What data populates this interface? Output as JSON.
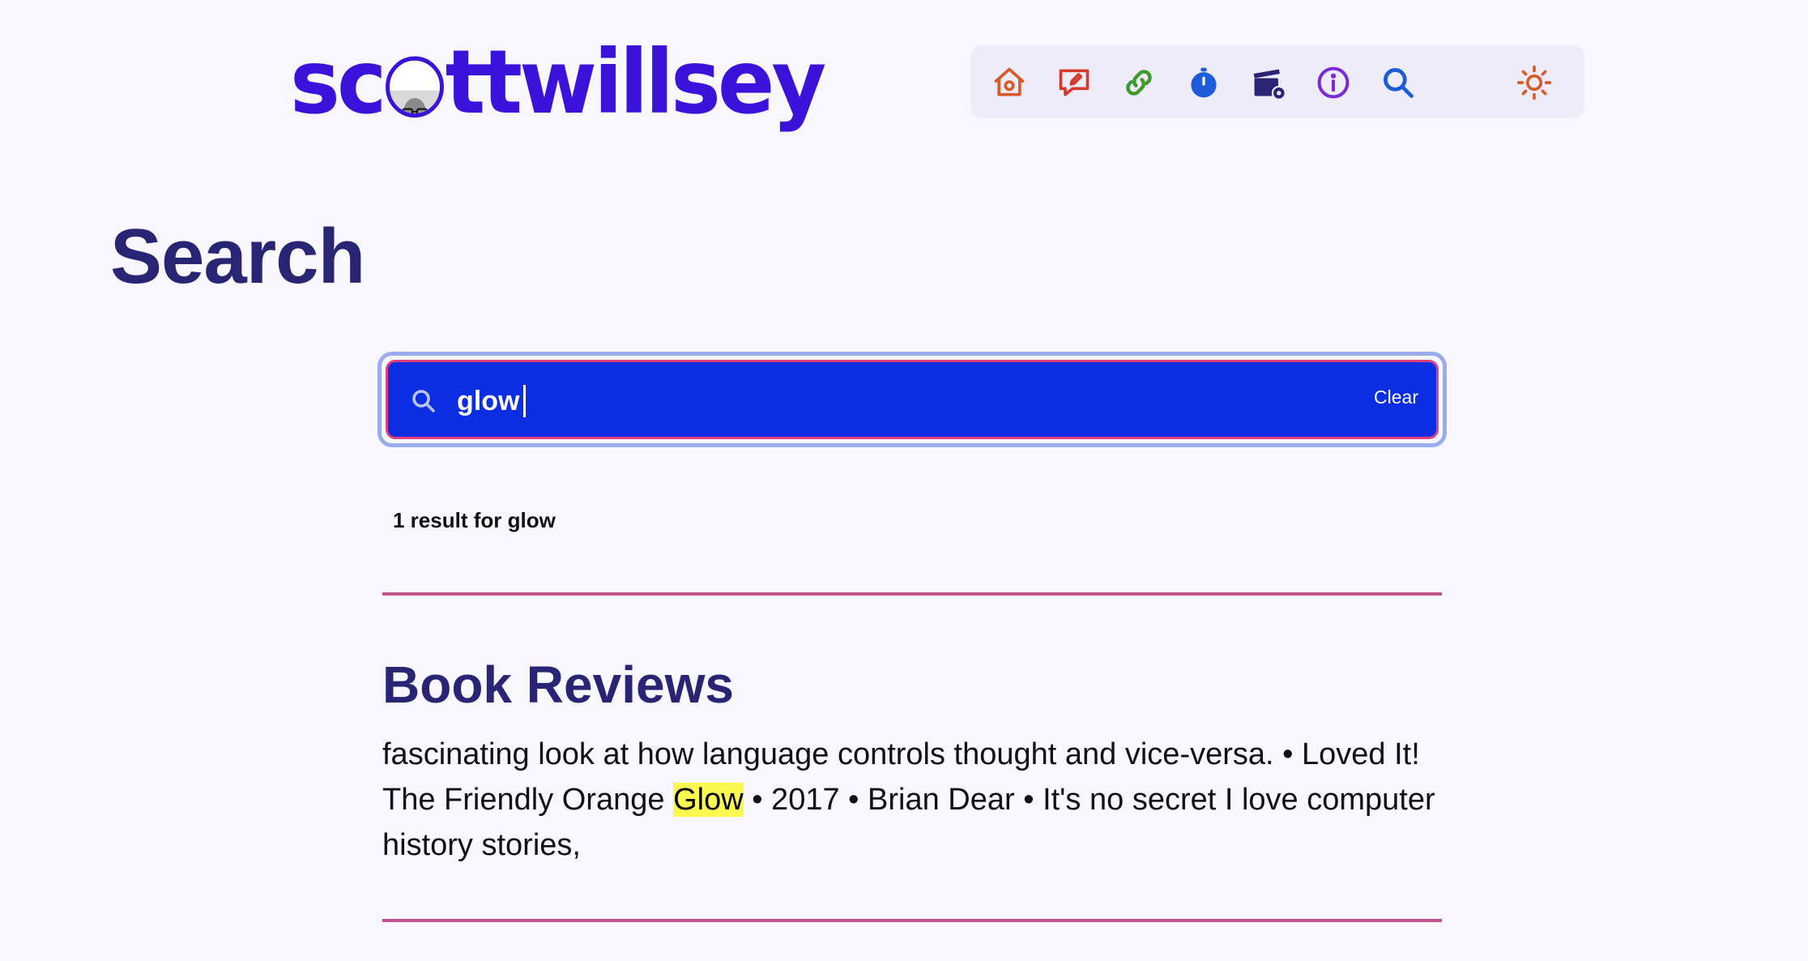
{
  "site": {
    "logo_prefix": "sc",
    "logo_suffix": "ttwillsey",
    "brand_color": "#3a12d9"
  },
  "nav": {
    "items": [
      {
        "name": "home-icon",
        "color": "#d65a2a"
      },
      {
        "name": "blog-edit-icon",
        "color": "#d63a2a"
      },
      {
        "name": "link-icon",
        "color": "#3f9a2e"
      },
      {
        "name": "stopwatch-icon",
        "color": "#1e5bd8"
      },
      {
        "name": "clapperboard-gear-icon",
        "color": "#2a2475"
      },
      {
        "name": "info-icon",
        "color": "#7a2ad6"
      },
      {
        "name": "search-icon",
        "color": "#1e5bd8"
      },
      {
        "name": "sun-icon",
        "color": "#d65a2a"
      }
    ]
  },
  "page": {
    "title": "Search"
  },
  "search": {
    "value": "glow",
    "clear_label": "Clear",
    "box_color": "#0c2ee3"
  },
  "results": {
    "count_text": "1 result for glow",
    "items": [
      {
        "title": "Book Reviews",
        "excerpt_before": "fascinating look at how language controls thought and vice-versa. • Loved It! The Friendly Orange ",
        "highlight": "Glow",
        "excerpt_after": " • 2017 • Brian Dear • It's no secret I love computer history stories,"
      }
    ]
  }
}
